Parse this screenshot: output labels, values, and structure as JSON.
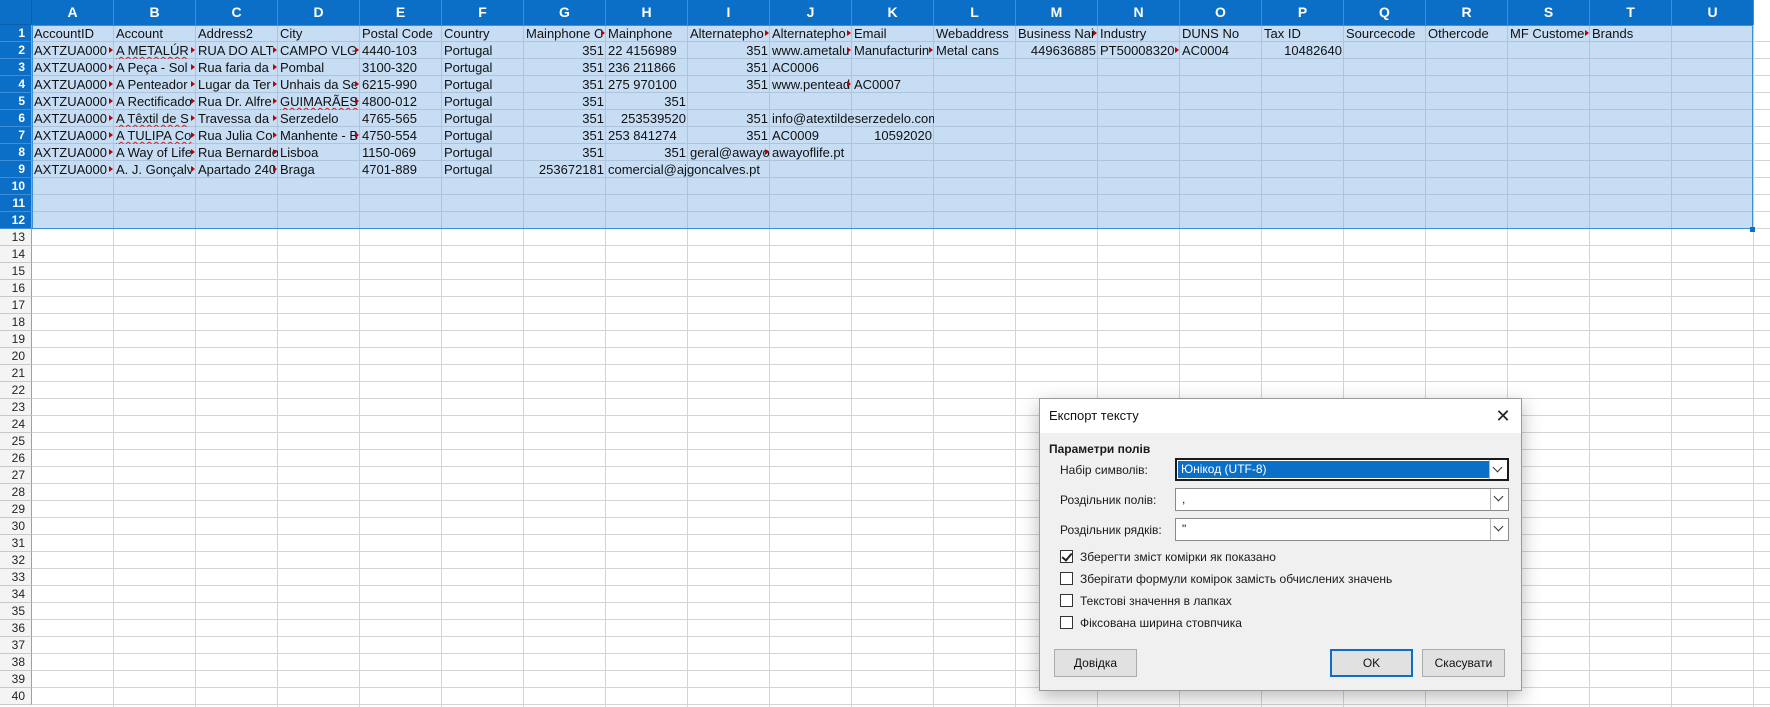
{
  "spreadsheet": {
    "columns": [
      "A",
      "B",
      "C",
      "D",
      "E",
      "F",
      "G",
      "H",
      "I",
      "J",
      "K",
      "L",
      "M",
      "N",
      "O",
      "P",
      "Q",
      "R",
      "S",
      "T",
      "U"
    ],
    "rows": [
      "1",
      "2",
      "3",
      "4",
      "5",
      "6",
      "7",
      "8",
      "9",
      "10",
      "11",
      "12",
      "13",
      "14",
      "15",
      "16",
      "17",
      "18",
      "19",
      "20",
      "21",
      "22",
      "23",
      "24",
      "25",
      "26",
      "27",
      "28",
      "29",
      "30",
      "31",
      "32",
      "33",
      "34",
      "35",
      "36",
      "37",
      "38",
      "39",
      "40"
    ],
    "selected_rows": 12,
    "cells": [
      {
        "r": 0,
        "c": 0,
        "v": "AccountID"
      },
      {
        "r": 0,
        "c": 1,
        "v": "Account"
      },
      {
        "r": 0,
        "c": 2,
        "v": "Address2"
      },
      {
        "r": 0,
        "c": 3,
        "v": "City"
      },
      {
        "r": 0,
        "c": 4,
        "v": "Postal Code"
      },
      {
        "r": 0,
        "c": 5,
        "v": "Country"
      },
      {
        "r": 0,
        "c": 6,
        "v": "Mainphone C",
        "t": 1
      },
      {
        "r": 0,
        "c": 7,
        "v": "Mainphone"
      },
      {
        "r": 0,
        "c": 8,
        "v": "Alternatepho",
        "t": 1
      },
      {
        "r": 0,
        "c": 9,
        "v": "Alternatepho",
        "t": 1
      },
      {
        "r": 0,
        "c": 10,
        "v": "Email"
      },
      {
        "r": 0,
        "c": 11,
        "v": "Webaddress"
      },
      {
        "r": 0,
        "c": 12,
        "v": "Business Nai",
        "t": 1
      },
      {
        "r": 0,
        "c": 13,
        "v": "Industry"
      },
      {
        "r": 0,
        "c": 14,
        "v": "DUNS No"
      },
      {
        "r": 0,
        "c": 15,
        "v": "Tax ID"
      },
      {
        "r": 0,
        "c": 16,
        "v": "Sourcecode"
      },
      {
        "r": 0,
        "c": 17,
        "v": "Othercode"
      },
      {
        "r": 0,
        "c": 18,
        "v": "MF Custome",
        "t": 1
      },
      {
        "r": 0,
        "c": 19,
        "v": "Brands"
      },
      {
        "r": 1,
        "c": 0,
        "v": "AXTZUA000",
        "t": 1
      },
      {
        "r": 1,
        "c": 1,
        "v": "A METALÚR",
        "t": 1,
        "s": 1
      },
      {
        "r": 1,
        "c": 2,
        "v": "RUA DO ALT",
        "t": 1
      },
      {
        "r": 1,
        "c": 3,
        "v": "CAMPO VLG",
        "t": 1
      },
      {
        "r": 1,
        "c": 4,
        "v": "4440-103"
      },
      {
        "r": 1,
        "c": 5,
        "v": "Portugal"
      },
      {
        "r": 1,
        "c": 6,
        "v": "351",
        "n": 1
      },
      {
        "r": 1,
        "c": 7,
        "v": "22 4156989"
      },
      {
        "r": 1,
        "c": 8,
        "v": "351",
        "n": 1
      },
      {
        "r": 1,
        "c": 9,
        "v": "www.ametalu",
        "t": 1
      },
      {
        "r": 1,
        "c": 10,
        "v": "Manufacturin",
        "t": 1
      },
      {
        "r": 1,
        "c": 11,
        "v": "Metal cans"
      },
      {
        "r": 1,
        "c": 12,
        "v": "449636885",
        "n": 1
      },
      {
        "r": 1,
        "c": 13,
        "v": "PT50008320",
        "t": 1
      },
      {
        "r": 1,
        "c": 14,
        "v": "AC0004"
      },
      {
        "r": 1,
        "c": 15,
        "v": "10482640",
        "n": 1
      },
      {
        "r": 2,
        "c": 0,
        "v": "AXTZUA000",
        "t": 1
      },
      {
        "r": 2,
        "c": 1,
        "v": "A Peça - Sol",
        "t": 1
      },
      {
        "r": 2,
        "c": 2,
        "v": "Rua faria da",
        "t": 1
      },
      {
        "r": 2,
        "c": 3,
        "v": "Pombal"
      },
      {
        "r": 2,
        "c": 4,
        "v": "3100-320"
      },
      {
        "r": 2,
        "c": 5,
        "v": "Portugal"
      },
      {
        "r": 2,
        "c": 6,
        "v": "351",
        "n": 1
      },
      {
        "r": 2,
        "c": 7,
        "v": "236 211866"
      },
      {
        "r": 2,
        "c": 8,
        "v": "351",
        "n": 1
      },
      {
        "r": 2,
        "c": 9,
        "v": "AC0006"
      },
      {
        "r": 3,
        "c": 0,
        "v": "AXTZUA000",
        "t": 1
      },
      {
        "r": 3,
        "c": 1,
        "v": "A Penteador",
        "t": 1
      },
      {
        "r": 3,
        "c": 2,
        "v": "Lugar da Ter",
        "t": 1
      },
      {
        "r": 3,
        "c": 3,
        "v": "Unhais da Se",
        "t": 1
      },
      {
        "r": 3,
        "c": 4,
        "v": "6215-990"
      },
      {
        "r": 3,
        "c": 5,
        "v": "Portugal"
      },
      {
        "r": 3,
        "c": 6,
        "v": "351",
        "n": 1
      },
      {
        "r": 3,
        "c": 7,
        "v": "275 970100"
      },
      {
        "r": 3,
        "c": 8,
        "v": "351",
        "n": 1
      },
      {
        "r": 3,
        "c": 9,
        "v": "www.pentead",
        "t": 1
      },
      {
        "r": 3,
        "c": 10,
        "v": "AC0007"
      },
      {
        "r": 4,
        "c": 0,
        "v": "AXTZUA000",
        "t": 1
      },
      {
        "r": 4,
        "c": 1,
        "v": "A Rectificado",
        "t": 1
      },
      {
        "r": 4,
        "c": 2,
        "v": "Rua Dr. Alfre",
        "t": 1
      },
      {
        "r": 4,
        "c": 3,
        "v": "GUIMARÃES",
        "t": 1,
        "s": 1
      },
      {
        "r": 4,
        "c": 4,
        "v": "4800-012"
      },
      {
        "r": 4,
        "c": 5,
        "v": "Portugal"
      },
      {
        "r": 4,
        "c": 6,
        "v": "351",
        "n": 1
      },
      {
        "r": 4,
        "c": 7,
        "v": "351",
        "n": 1
      },
      {
        "r": 5,
        "c": 0,
        "v": "AXTZUA000",
        "t": 1
      },
      {
        "r": 5,
        "c": 1,
        "v": "A Têxtil de S",
        "t": 1,
        "s": 1
      },
      {
        "r": 5,
        "c": 2,
        "v": "Travessa da",
        "t": 1
      },
      {
        "r": 5,
        "c": 3,
        "v": "Serzedelo"
      },
      {
        "r": 5,
        "c": 4,
        "v": "4765-565"
      },
      {
        "r": 5,
        "c": 5,
        "v": "Portugal"
      },
      {
        "r": 5,
        "c": 6,
        "v": "351",
        "n": 1
      },
      {
        "r": 5,
        "c": 7,
        "v": "253539520",
        "n": 1
      },
      {
        "r": 5,
        "c": 8,
        "v": "351",
        "n": 1
      },
      {
        "r": 5,
        "c": 9,
        "v": "info@atextildeserzedelo.com",
        "w": 2
      },
      {
        "r": 6,
        "c": 0,
        "v": "AXTZUA000",
        "t": 1
      },
      {
        "r": 6,
        "c": 1,
        "v": "A TULIPA Co",
        "t": 1,
        "s": 1
      },
      {
        "r": 6,
        "c": 2,
        "v": "Rua Julia Co",
        "t": 1
      },
      {
        "r": 6,
        "c": 3,
        "v": "Manhente - B",
        "t": 1
      },
      {
        "r": 6,
        "c": 4,
        "v": "4750-554"
      },
      {
        "r": 6,
        "c": 5,
        "v": "Portugal"
      },
      {
        "r": 6,
        "c": 6,
        "v": "351",
        "n": 1
      },
      {
        "r": 6,
        "c": 7,
        "v": "253 841274"
      },
      {
        "r": 6,
        "c": 8,
        "v": "351",
        "n": 1
      },
      {
        "r": 6,
        "c": 9,
        "v": "AC0009"
      },
      {
        "r": 6,
        "c": 10,
        "v": "10592020",
        "n": 1
      },
      {
        "r": 7,
        "c": 0,
        "v": "AXTZUA000",
        "t": 1
      },
      {
        "r": 7,
        "c": 1,
        "v": "A Way of Life",
        "t": 1
      },
      {
        "r": 7,
        "c": 2,
        "v": "Rua Bernardo",
        "t": 1
      },
      {
        "r": 7,
        "c": 3,
        "v": "Lisboa"
      },
      {
        "r": 7,
        "c": 4,
        "v": "1150-069"
      },
      {
        "r": 7,
        "c": 5,
        "v": "Portugal"
      },
      {
        "r": 7,
        "c": 6,
        "v": "351",
        "n": 1
      },
      {
        "r": 7,
        "c": 7,
        "v": "351",
        "n": 1
      },
      {
        "r": 7,
        "c": 8,
        "v": "geral@awayo",
        "t": 1
      },
      {
        "r": 7,
        "c": 9,
        "v": "awayoflife.pt"
      },
      {
        "r": 8,
        "c": 0,
        "v": "AXTZUA000",
        "t": 1
      },
      {
        "r": 8,
        "c": 1,
        "v": "A. J. Gonçalv",
        "t": 1
      },
      {
        "r": 8,
        "c": 2,
        "v": "Apartado 240",
        "t": 1
      },
      {
        "r": 8,
        "c": 3,
        "v": "Braga"
      },
      {
        "r": 8,
        "c": 4,
        "v": "4701-889"
      },
      {
        "r": 8,
        "c": 5,
        "v": "Portugal"
      },
      {
        "r": 8,
        "c": 6,
        "v": "253672181",
        "n": 1
      },
      {
        "r": 8,
        "c": 7,
        "v": "comercial@ajgoncalves.pt",
        "w": 2
      }
    ]
  },
  "dialog": {
    "title": "Експорт тексту",
    "close_glyph": "✕",
    "section": "Параметри полів",
    "charset_label": "Набір символів:",
    "charset_value": "Юнікод (UTF-8)",
    "field_sep_label": "Роздільник полів:",
    "field_sep_value": ",",
    "string_sep_label": "Роздільник рядків:",
    "string_sep_value": "\"",
    "opt_save_as_shown": "Зберегти зміст комірки як показано",
    "opt_save_formulas": "Зберігати формули комірок замість обчислених значень",
    "opt_quote_text": "Текстові значення в лапках",
    "opt_fixed_width": "Фіксована ширина стовпчика",
    "checked_save_as_shown": true,
    "checked_save_formulas": false,
    "checked_quote_text": false,
    "checked_fixed_width": false,
    "help_label": "Довідка",
    "ok_label": "OK",
    "cancel_label": "Скасувати"
  },
  "colors": {
    "header_blue": "#0b6fc7",
    "selection": "#78afe4"
  }
}
